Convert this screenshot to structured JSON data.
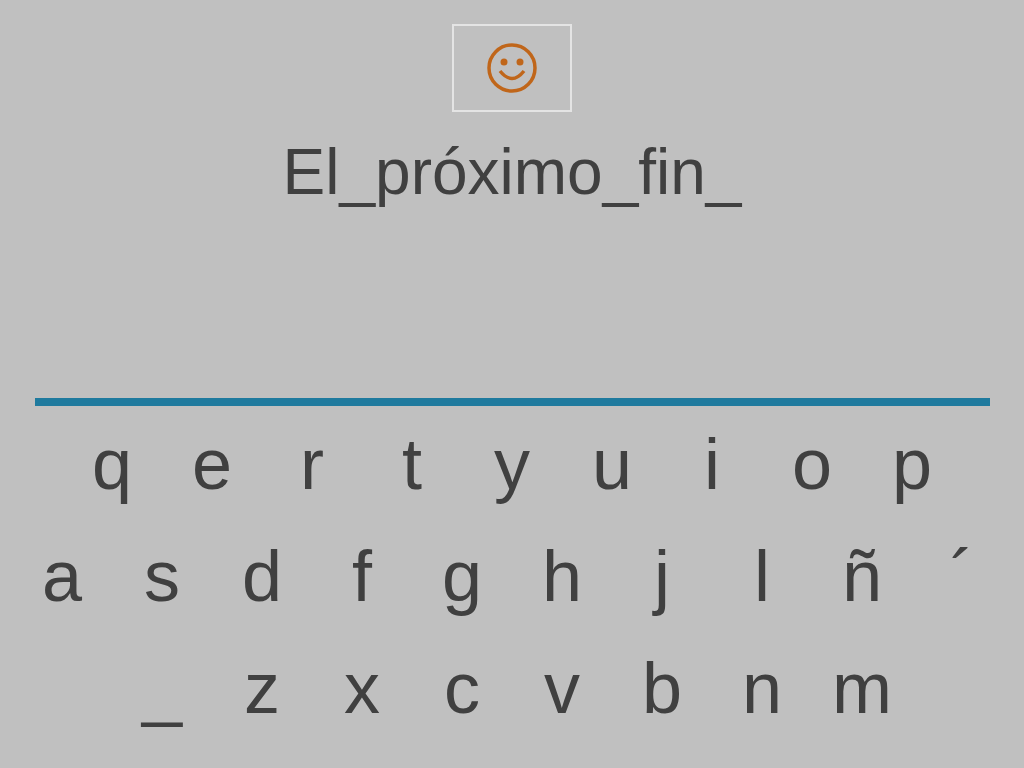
{
  "prompt": "El_próximo_fin_",
  "keyboard": {
    "rows": [
      [
        "q",
        "e",
        "r",
        "t",
        "y",
        "u",
        "i",
        "o",
        "p"
      ],
      [
        "a",
        "s",
        "d",
        "f",
        "g",
        "h",
        "j",
        "l",
        "ñ",
        "´"
      ],
      [
        "_",
        "z",
        "x",
        "c",
        "v",
        "b",
        "n",
        "m"
      ]
    ]
  }
}
